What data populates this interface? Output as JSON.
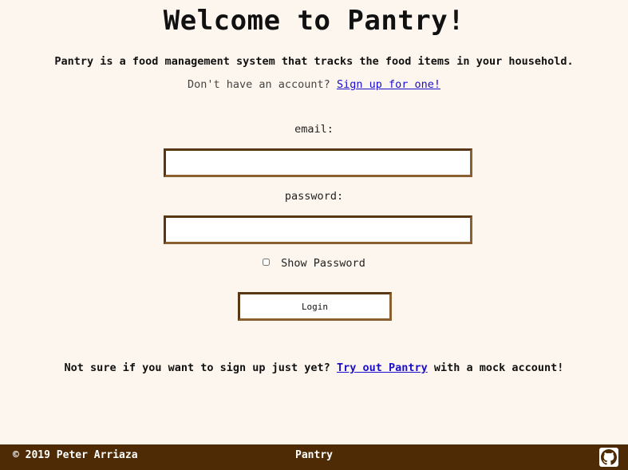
{
  "header": {
    "title": "Welcome to Pantry!",
    "subtitle": "Pantry is a food management system that tracks the food items in your household.",
    "signup_prompt": "Don't have an account?",
    "signup_link": "Sign up for one!"
  },
  "form": {
    "email_label": "email:",
    "email_value": "",
    "password_label": "password:",
    "password_value": "",
    "show_password_label": "Show Password",
    "show_password_checked": false,
    "login_label": "Login"
  },
  "mock": {
    "prefix": "Not sure if you want to sign up just yet?",
    "link": "Try out Pantry",
    "suffix": "with a mock account!"
  },
  "footer": {
    "copyright": "© 2019 Peter Arriaza",
    "brand": "Pantry",
    "github_icon": "github-icon"
  },
  "colors": {
    "background": "#fdf6ee",
    "footer": "#4e2a05",
    "border": "#5a3714",
    "link": "#1a0dcc"
  }
}
